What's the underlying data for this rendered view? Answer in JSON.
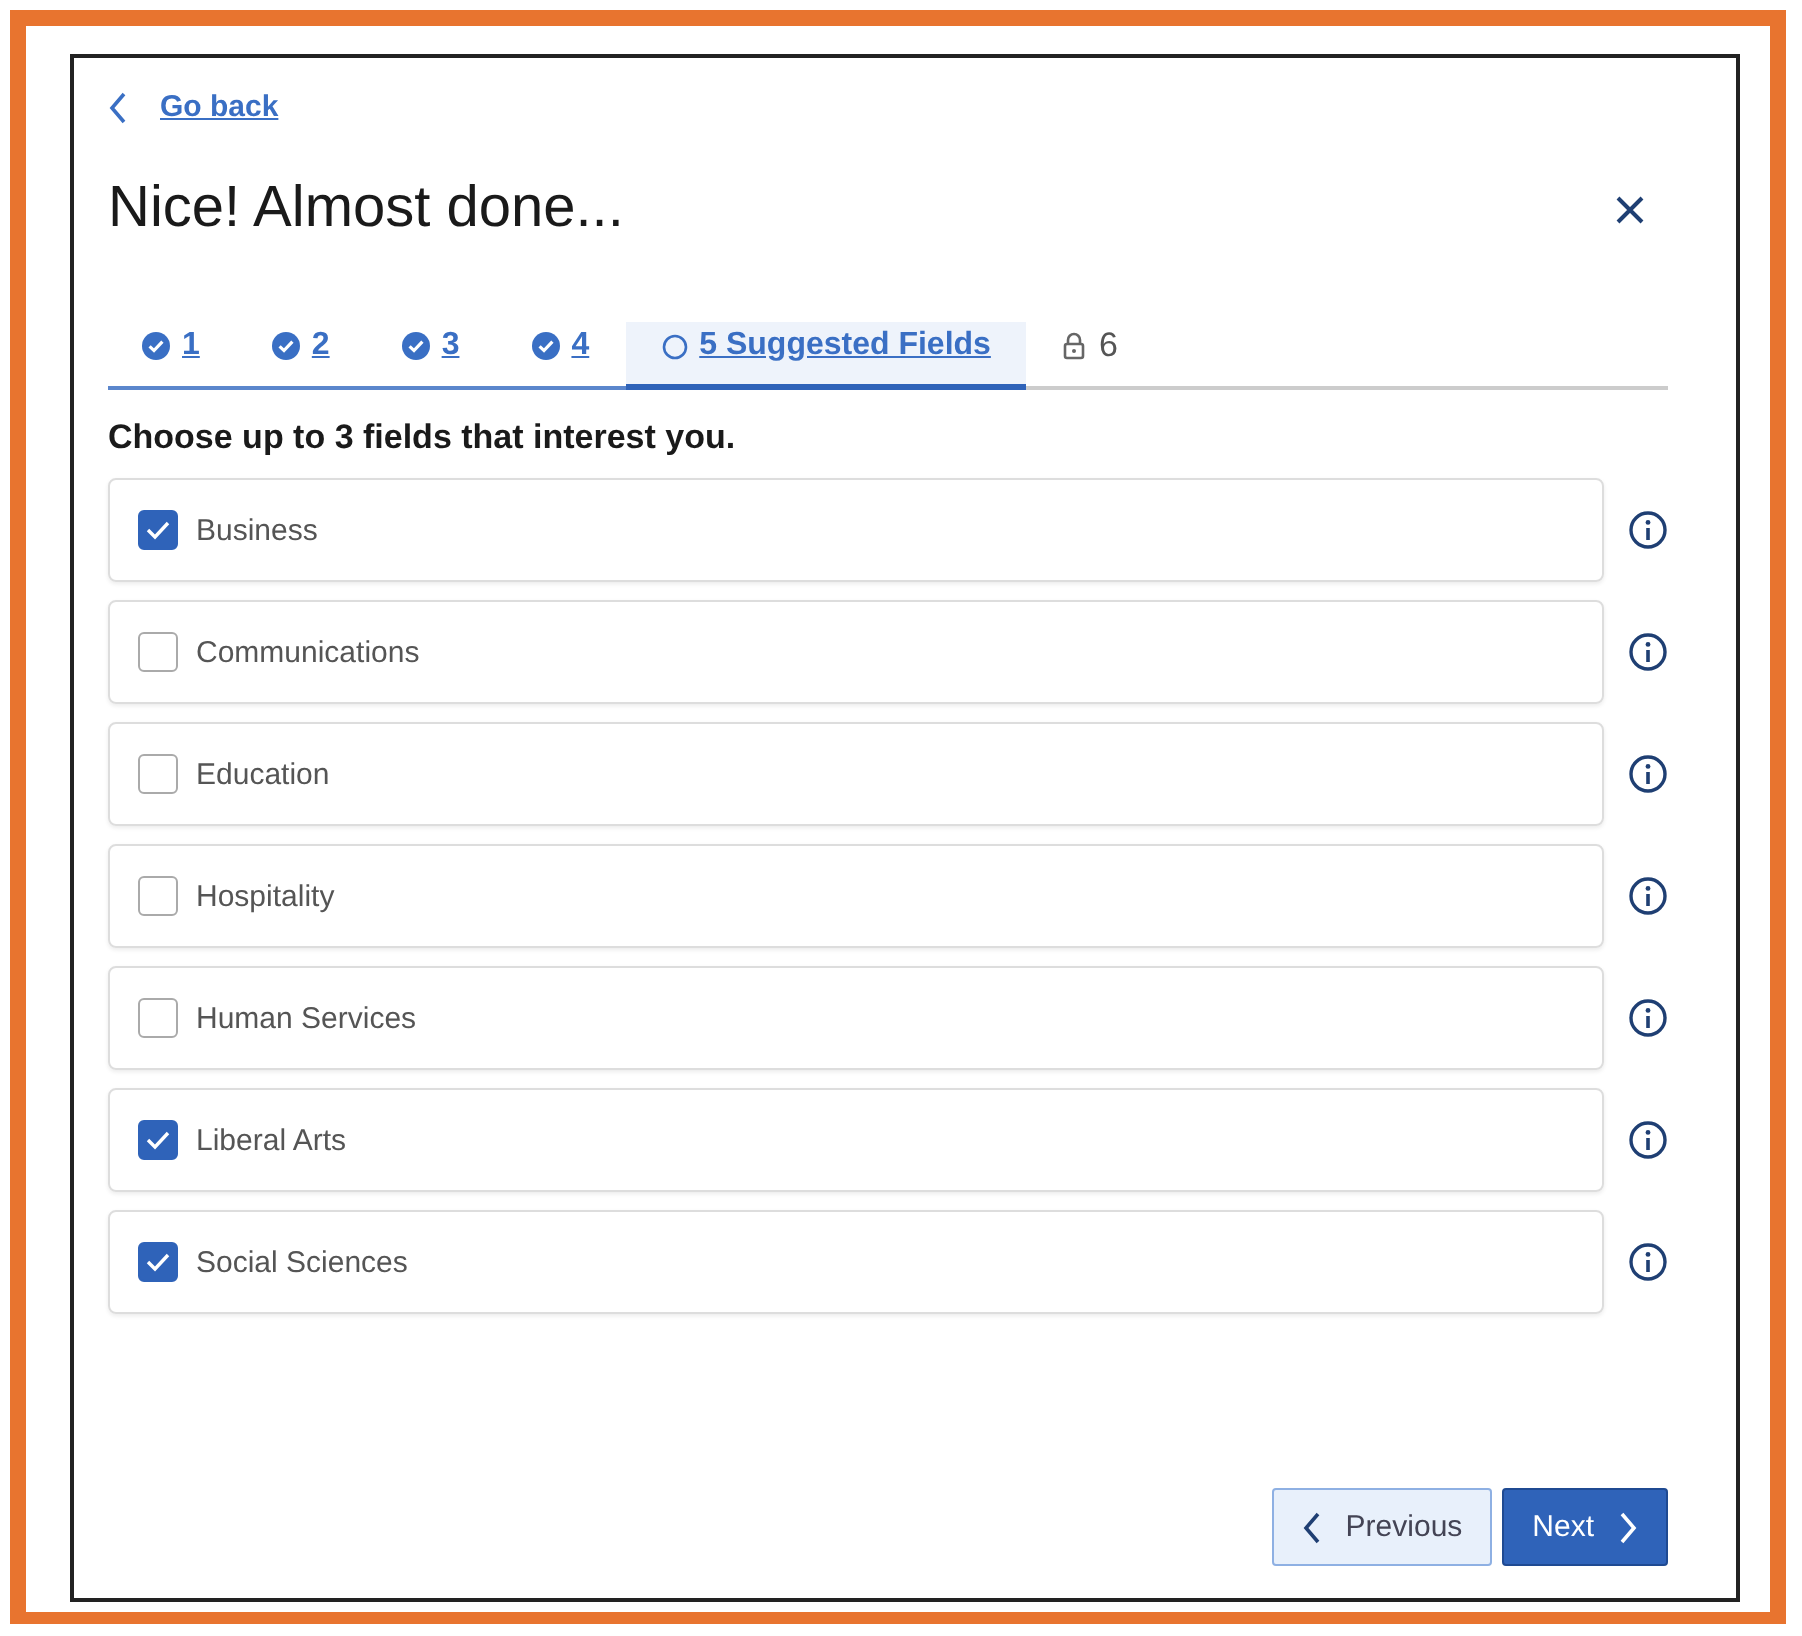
{
  "back_link": "Go back",
  "title": "Nice! Almost done...",
  "steps": [
    {
      "kind": "done",
      "label": "1",
      "selected": false
    },
    {
      "kind": "done",
      "label": "2",
      "selected": false
    },
    {
      "kind": "done",
      "label": "3",
      "selected": false
    },
    {
      "kind": "done",
      "label": "4",
      "selected": false
    },
    {
      "kind": "current",
      "label": "5 Suggested Fields",
      "selected": true
    },
    {
      "kind": "locked",
      "label": "6",
      "selected": false
    }
  ],
  "prompt": "Choose up to 3 fields that interest you.",
  "options": [
    {
      "label": "Business",
      "checked": true
    },
    {
      "label": "Communications",
      "checked": false
    },
    {
      "label": "Education",
      "checked": false
    },
    {
      "label": "Hospitality",
      "checked": false
    },
    {
      "label": "Human Services",
      "checked": false
    },
    {
      "label": "Liberal Arts",
      "checked": true
    },
    {
      "label": "Social Sciences",
      "checked": true
    }
  ],
  "buttons": {
    "previous": "Previous",
    "next": "Next"
  }
}
